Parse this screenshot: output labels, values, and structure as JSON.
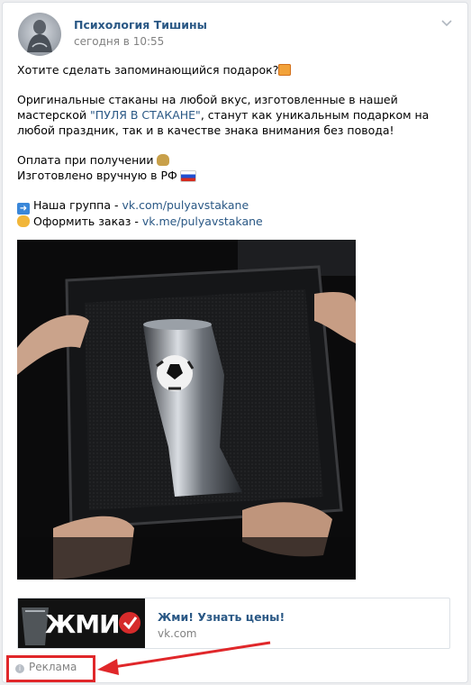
{
  "post": {
    "author": "Психология Тишины",
    "date": "сегодня в 10:55",
    "paragraphs": {
      "p1": "Хотите сделать запоминающийся подарок?",
      "p2_a": "Оригинальные стаканы на любой вкус, изготовленные в нашей мастерской ",
      "p2_brand": "\"ПУЛЯ В СТАКАНЕ\"",
      "p2_b": ", станут как уникальным подарком на любой праздник, так и в качестве знака внимания без повода!",
      "p3": "Оплата при получении",
      "p4": "Изготовлено вручную в РФ",
      "group_label": "Наша группа - ",
      "group_link": "vk.com/pulyavstakane",
      "order_label": "Оформить заказ - ",
      "order_link": "vk.me/pulyavstakane"
    }
  },
  "ad": {
    "thumb_text": "ЖМИ",
    "title": "Жми! Узнать цены!",
    "domain": "vk.com",
    "label": "Реклама",
    "info_glyph": "i"
  },
  "icons": {
    "gift": "gift-emoji",
    "money_bag": "money-bag-emoji",
    "russia_flag": "russia-flag-emoji",
    "right_arrow": "right-arrow-emoji",
    "pointing_hand": "pointing-hand-emoji"
  },
  "colors": {
    "link": "#2a5885",
    "muted": "#828282",
    "highlight": "#e0272a"
  }
}
